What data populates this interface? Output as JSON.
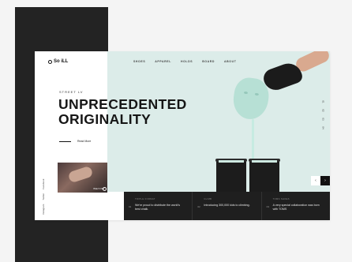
{
  "logo": {
    "text": "So iLL"
  },
  "nav": {
    "items": [
      "SHOES",
      "APPAREL",
      "HOLDS",
      "BOARD",
      "ABOUT"
    ]
  },
  "hero": {
    "eyebrow": "STREET LV",
    "headline_line1": "UNPRECEDENTED",
    "headline_line2": "ORIGINALITY",
    "cta": "Read More"
  },
  "social": {
    "items": [
      "Facebook",
      "Twitter",
      "Instagram"
    ]
  },
  "thumbnail": {
    "caption": "Watch film"
  },
  "side_pagination": {
    "items": [
      "01",
      "02",
      "03",
      "04"
    ]
  },
  "slider_controls": {
    "prev": "‹",
    "next": "›"
  },
  "news": [
    {
      "num": "01",
      "kicker": "TRIPLE FORMAT",
      "text": "We're proud to distribute the world's best chalk."
    },
    {
      "num": "02",
      "kicker": "CLIMB",
      "text": "Introducing 300,000 kids to climbing."
    },
    {
      "num": "03",
      "kicker": "TOMS SHOES",
      "text": "A very special collaboration was born with TOMS"
    }
  ],
  "colors": {
    "hero_bg": "#dcece9",
    "dark": "#1f1f1f",
    "mint": "#b7e0d5"
  }
}
